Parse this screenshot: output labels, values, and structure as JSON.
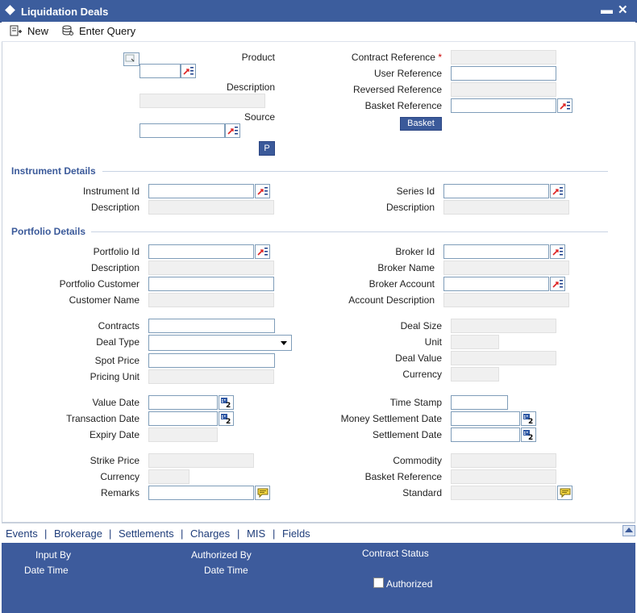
{
  "window": {
    "title": "Liquidation Deals"
  },
  "toolbar": {
    "new_label": "New",
    "enter_query_label": "Enter Query"
  },
  "header": {
    "product_label": "Product",
    "description_label": "Description",
    "source_label": "Source",
    "p_button": "P",
    "contract_reference_label": "Contract Reference",
    "required_marker": "*",
    "user_reference_label": "User Reference",
    "reversed_reference_label": "Reversed Reference",
    "basket_reference_label": "Basket Reference",
    "basket_button": "Basket"
  },
  "instrument": {
    "section_title": "Instrument Details",
    "instrument_id_label": "Instrument Id",
    "description_label": "Description",
    "series_id_label": "Series Id",
    "series_description_label": "Description"
  },
  "portfolio": {
    "section_title": "Portfolio Details",
    "portfolio_id_label": "Portfolio Id",
    "description_label": "Description",
    "portfolio_customer_label": "Portfolio Customer",
    "customer_name_label": "Customer Name",
    "broker_id_label": "Broker Id",
    "broker_name_label": "Broker Name",
    "broker_account_label": "Broker Account",
    "account_description_label": "Account Description"
  },
  "deal": {
    "contracts_label": "Contracts",
    "deal_type_label": "Deal Type",
    "spot_price_label": "Spot Price",
    "pricing_unit_label": "Pricing Unit",
    "deal_size_label": "Deal Size",
    "unit_label": "Unit",
    "deal_value_label": "Deal Value",
    "currency_label": "Currency"
  },
  "dates": {
    "value_date_label": "Value Date",
    "transaction_date_label": "Transaction Date",
    "expiry_date_label": "Expiry Date",
    "time_stamp_label": "Time Stamp",
    "money_settlement_date_label": "Money Settlement Date",
    "settlement_date_label": "Settlement Date"
  },
  "other": {
    "strike_price_label": "Strike Price",
    "currency_label": "Currency",
    "remarks_label": "Remarks",
    "commodity_label": "Commodity",
    "basket_reference_label": "Basket Reference",
    "standard_label": "Standard"
  },
  "tabs": [
    {
      "label": "Events"
    },
    {
      "label": "Brokerage"
    },
    {
      "label": "Settlements"
    },
    {
      "label": "Charges"
    },
    {
      "label": "MIS"
    },
    {
      "label": "Fields"
    }
  ],
  "tab_separator": "|",
  "footer": {
    "input_by_label": "Input By",
    "date_time_label": "Date Time",
    "authorized_by_label": "Authorized By",
    "auth_date_time_label": "Date Time",
    "contract_status_label": "Contract Status",
    "authorized_label": "Authorized"
  },
  "colors": {
    "titlebar": "#3c5d9d",
    "footer": "#3d5b9c",
    "section_title": "#3b5a9a",
    "tab_text": "#1f3d7a",
    "required": "#cc0000"
  },
  "icons": {
    "lov": "lov-icon",
    "calendar": "calendar-icon",
    "remarks": "speech-bubble-icon"
  }
}
